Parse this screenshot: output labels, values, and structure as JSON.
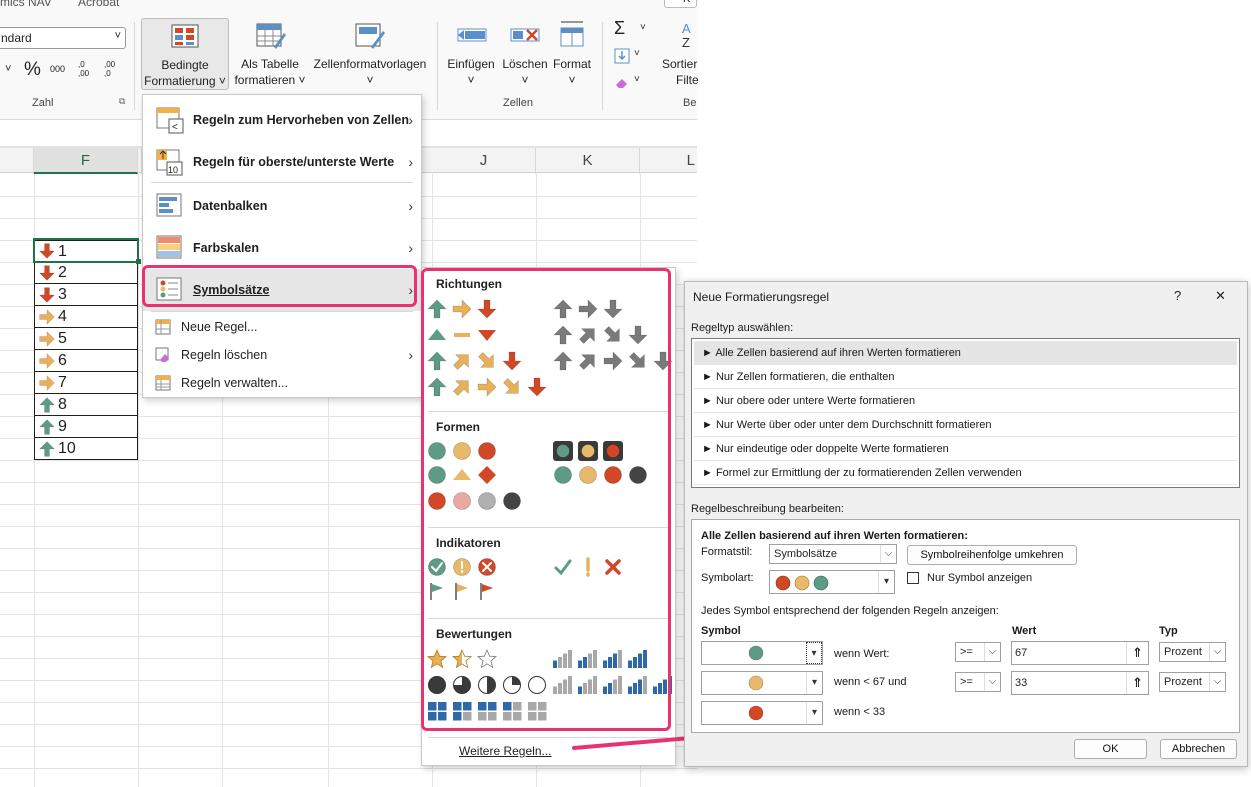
{
  "ribbon": {
    "tab_left": "mics NAV",
    "tab_acrobat": "Acrobat",
    "number_format": "ndard",
    "percent": "%",
    "thousands": "000",
    "dec_increase": ",0 ,00",
    "dec_decrease": ",00 ,0",
    "group_number": "Zahl",
    "cond_format_line1": "Bedingte",
    "cond_format_line2": "Formatierung ˅",
    "as_table_line1": "Als Tabelle",
    "as_table_line2": "formatieren ˅",
    "cell_styles_line1": "Zellenformatvorlagen",
    "cell_styles_line2": "˅",
    "insert_label": "Einfügen",
    "delete_label": "Löschen",
    "format_label": "Format",
    "group_cells": "Zellen",
    "sort_line1": "Sortier",
    "sort_line2": "Filte",
    "group_edit": "Be",
    "sigma": "Σ",
    "top_right": "K"
  },
  "sheet": {
    "columns": [
      {
        "label": "F"
      },
      {
        "label": "J"
      },
      {
        "label": "K"
      },
      {
        "label": "L"
      }
    ],
    "rows": [
      {
        "value": "1",
        "icon": "down"
      },
      {
        "value": "2",
        "icon": "down"
      },
      {
        "value": "3",
        "icon": "down"
      },
      {
        "value": "4",
        "icon": "right"
      },
      {
        "value": "5",
        "icon": "right"
      },
      {
        "value": "6",
        "icon": "right"
      },
      {
        "value": "7",
        "icon": "right"
      },
      {
        "value": "8",
        "icon": "up"
      },
      {
        "value": "9",
        "icon": "up"
      },
      {
        "value": "10",
        "icon": "up"
      }
    ],
    "colors": {
      "down": "#d24726",
      "right": "#e8b05a",
      "up": "#5d9b86"
    }
  },
  "menu": {
    "items": [
      {
        "label": "Regeln zum Hervorheben von Zellen",
        "icon": "highlight-rules-icon"
      },
      {
        "label": "Regeln für oberste/unterste Werte",
        "icon": "top-bottom-icon"
      },
      {
        "label": "Datenbalken",
        "icon": "data-bars-icon"
      },
      {
        "label": "Farbskalen",
        "icon": "color-scales-icon"
      },
      {
        "label": "Symbolsätze",
        "icon": "icon-sets-icon"
      },
      {
        "label": "Neue Regel...",
        "icon": "new-rule-icon"
      },
      {
        "label": "Regeln löschen",
        "icon": "clear-rules-icon"
      },
      {
        "label": "Regeln verwalten...",
        "icon": "manage-rules-icon"
      }
    ],
    "chevron": "›"
  },
  "submenu": {
    "sections": [
      {
        "title": "Richtungen"
      },
      {
        "title": "Formen"
      },
      {
        "title": "Indikatoren"
      },
      {
        "title": "Bewertungen"
      }
    ],
    "more_rules": "Weitere Regeln..."
  },
  "dialog": {
    "title": "Neue Formatierungsregel",
    "help": "?",
    "close": "✕",
    "ruletype_label": "Regeltyp auswählen:",
    "ruletypes": [
      "► Alle Zellen basierend auf ihren Werten formatieren",
      "► Nur Zellen formatieren, die enthalten",
      "► Nur obere oder untere Werte formatieren",
      "► Nur Werte über oder unter dem Durchschnitt formatieren",
      "► Nur eindeutige oder doppelte Werte formatieren",
      "► Formel zur Ermittlung der zu formatierenden Zellen verwenden"
    ],
    "desc_label": "Regelbeschreibung bearbeiten:",
    "desc_heading": "Alle Zellen basierend auf ihren Werten formatieren:",
    "formatstil_label": "Formatstil:",
    "formatstil_value": "Symbolsätze",
    "reverse_button": "Symbolreihenfolge umkehren",
    "symbolart_label": "Symbolart:",
    "only_symbol_label": "Nur Symbol anzeigen",
    "rules_intro": "Jedes Symbol entsprechend der folgenden Regeln anzeigen:",
    "col_symbol": "Symbol",
    "col_wert": "Wert",
    "col_typ": "Typ",
    "rules": [
      {
        "color": "#5d9b86",
        "cond": "wenn Wert:",
        "op": ">=",
        "value": "67",
        "type": "Prozent"
      },
      {
        "color": "#e8b96a",
        "cond": "wenn < 67 und",
        "op": ">=",
        "value": "33",
        "type": "Prozent"
      },
      {
        "color": "#d24726",
        "cond": "wenn < 33"
      }
    ],
    "ok": "OK",
    "cancel": "Abbrechen"
  },
  "accent": "#e8336d"
}
